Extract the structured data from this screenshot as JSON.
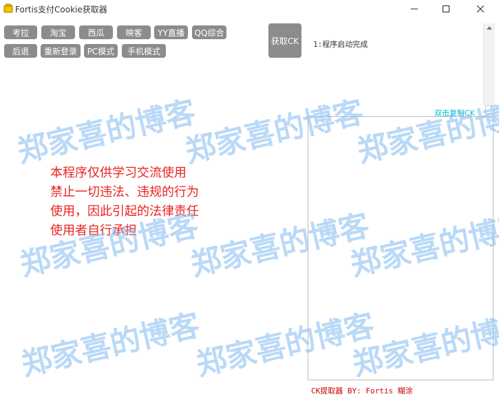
{
  "window": {
    "title": "Fortis支付Cookie获取器"
  },
  "toolbar": {
    "row1": [
      "考拉",
      "淘宝",
      "西瓜",
      "映客",
      "YY直播",
      "QQ综合"
    ],
    "row2": [
      "后退",
      "重新登录",
      "PC模式",
      "手机模式"
    ]
  },
  "ck_button": "获取CK",
  "log": {
    "line1": "1:程序启动完成"
  },
  "ck_panel": {
    "copy_hint": "双击复制CK"
  },
  "disclaimer": {
    "line1": "本程序仅供学习交流使用",
    "line2": "禁止一切违法、违规的行为",
    "line3": "使用，因此引起的法律责任",
    "line4": "使用者自行承担"
  },
  "footer": {
    "credit": "CK提取器 BY: Fortis  糊涂"
  },
  "watermark": {
    "text": "郑家喜的博客"
  },
  "colors": {
    "button_bg": "#8c8c8c",
    "disclaimer_text": "#e8231f",
    "footer_text": "#cc0000",
    "copy_hint": "#00bcd4",
    "watermark": "#82b9f0"
  }
}
